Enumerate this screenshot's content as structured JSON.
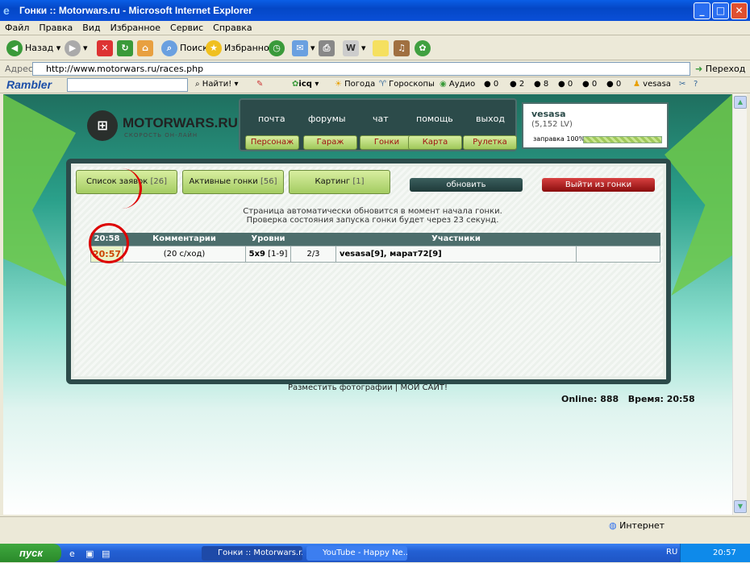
{
  "window": {
    "title": "Гонки :: Motorwars.ru - Microsoft Internet Explorer",
    "btn_min": "_",
    "btn_max": "□",
    "btn_close": "✕"
  },
  "menu": {
    "items": [
      "Файл",
      "Правка",
      "Вид",
      "Избранное",
      "Сервис",
      "Справка"
    ]
  },
  "toolbar": {
    "back": "Назад",
    "search": "Поиск",
    "favorites": "Избранное"
  },
  "address": {
    "label": "Адрес:",
    "url": "http://www.motorwars.ru/races.php",
    "go": "Переход"
  },
  "rambler": {
    "logo": "Rambler",
    "find": "Найти!",
    "icq": "icq",
    "weather": "Погода",
    "horoscope": "Гороскопы",
    "audio": "Аудио",
    "counts": [
      "0",
      "2",
      "8",
      "0",
      "0",
      "0"
    ],
    "user": "vesasa"
  },
  "site": {
    "logo_name": "MOTORWARS.RU",
    "logo_sub": "СКОРОСТЬ ОН-ЛАЙН",
    "topnav": [
      "почта",
      "форумы",
      "чат",
      "помощь",
      "выход"
    ],
    "botnav": [
      "Персонаж",
      "Гараж",
      "Гонки",
      "Карта",
      "Рулетка"
    ],
    "user": {
      "name": "vesasa",
      "level": "(5,152 LV)",
      "fuel_label": "заправка 100%",
      "fuel_pct": 100
    },
    "tabs": [
      {
        "label": "Список заявок",
        "count": "[26]"
      },
      {
        "label": "Активные гонки",
        "count": "[56]"
      },
      {
        "label": "Картинг",
        "count": "[1]"
      }
    ],
    "refresh": "обновить",
    "leave": "Выйти из гонки",
    "notice1": "Страница автоматически обновится в момент начала гонки.",
    "notice2": "Проверка состояния запуска гонки будет через 23 секунд.",
    "table": {
      "headers": [
        "20:58",
        "Комментарии",
        "Уровни",
        "",
        "Участники",
        ""
      ],
      "row": {
        "time": "20:57",
        "comment": "(20 с/ход)",
        "track": "5x9",
        "levels": "[1-9]",
        "slots": "2/3",
        "participants": "vesasa[9], марат72[9]"
      }
    },
    "footer": "Разместить фотографии | МОЙ САЙТ!",
    "online": "Online: 888   Время: 20:58"
  },
  "status": {
    "zone": "Интернет"
  },
  "taskbar": {
    "start": "пуск",
    "tasks": [
      "Гонки :: Motorwars.r...",
      "YouTube - Happy Ne..."
    ],
    "lang": "RU",
    "clock": "20:57"
  }
}
